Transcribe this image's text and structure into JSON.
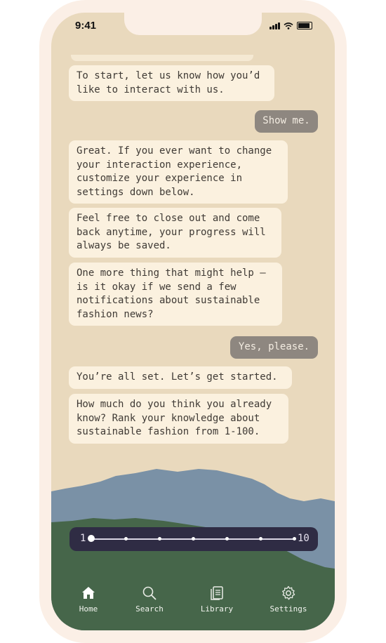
{
  "status_bar": {
    "time": "9:41",
    "icons": [
      "cellular-signal-icon",
      "wifi-icon",
      "battery-icon"
    ]
  },
  "conversation": {
    "messages": [
      {
        "sender": "bot",
        "text": "To start, let us know how you’d\nlike to interact with us."
      },
      {
        "sender": "user",
        "text": "Show me."
      },
      {
        "sender": "bot",
        "text": "Great. If you ever want to change\nyour interaction experience,\ncustomize your experience in\nsettings down below."
      },
      {
        "sender": "bot",
        "text": "Feel free to close out and come\nback anytime, your progress will\nalways be saved."
      },
      {
        "sender": "bot",
        "text": "One more thing that might help —\nis it okay if we send a few\nnotifications about sustainable\nfashion news?"
      },
      {
        "sender": "user",
        "text": "Yes, please."
      },
      {
        "sender": "bot",
        "text": "You’re all set. Let’s get started."
      },
      {
        "sender": "bot",
        "text": "How much do you think you already\nknow? Rank your knowledge about\nsustainable fashion from 1-100."
      }
    ]
  },
  "slider": {
    "min_label": "1",
    "max_label": "10",
    "value": 1,
    "steps": 7
  },
  "tabs": [
    {
      "label": "Home",
      "icon": "home-icon",
      "active": true
    },
    {
      "label": "Search",
      "icon": "search-icon",
      "active": false
    },
    {
      "label": "Library",
      "icon": "library-icon",
      "active": false
    },
    {
      "label": "Settings",
      "icon": "settings-gear-icon",
      "active": false
    }
  ],
  "colors": {
    "frame": "#fbefe6",
    "background": "#e9d9bd",
    "bot_bubble": "#fbf1df",
    "user_bubble": "#8e8780",
    "mountain_blue": "#7a91a6",
    "meadow_green": "#46664a",
    "slider_bg": "#2f2c44"
  }
}
